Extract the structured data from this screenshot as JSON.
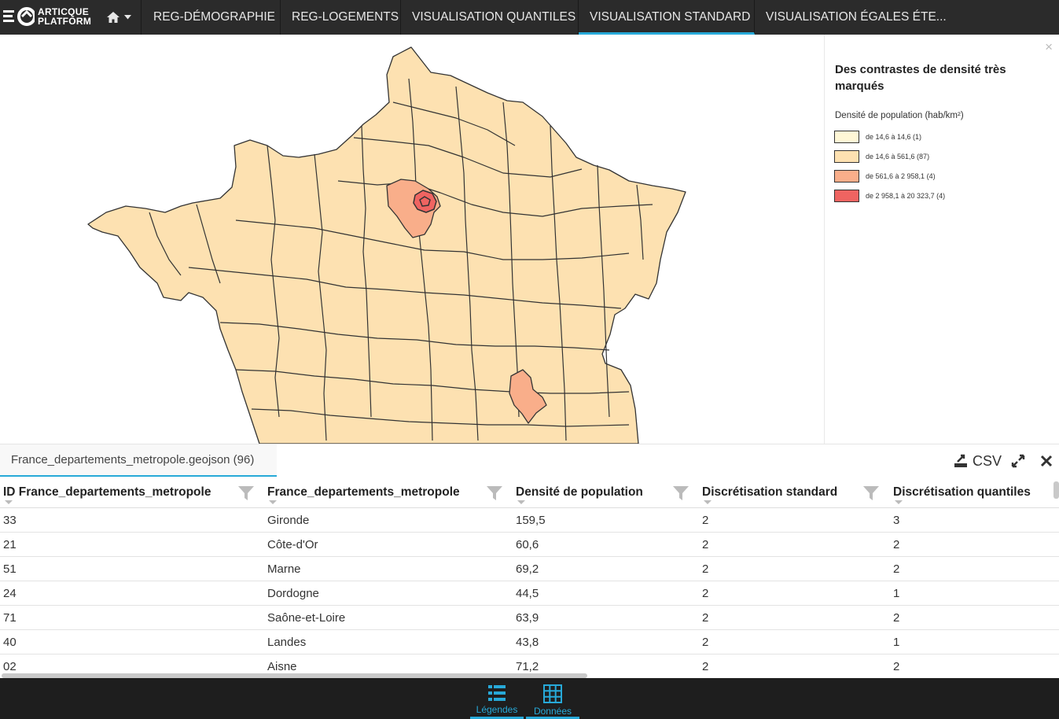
{
  "app": {
    "logo_line1": "ARTICQUE",
    "logo_line2": "PLATFORM"
  },
  "nav": {
    "tabs": [
      {
        "label": "REG-DÉMOGRAPHIE",
        "active": false
      },
      {
        "label": "REG-LOGEMENTS",
        "active": false
      },
      {
        "label": "VISUALISATION QUANTILES",
        "active": false
      },
      {
        "label": "VISUALISATION STANDARD",
        "active": true
      },
      {
        "label": "VISUALISATION ÉGALES ÉTE...",
        "active": false
      }
    ]
  },
  "legend": {
    "title": "Des contrastes de densité très marqués",
    "subtitle": "Densité de population (hab/km²)",
    "items": [
      {
        "label": "de 14,6 à 14,6 (1)",
        "color": "#fff7d6"
      },
      {
        "label": "de 14,6 à 561,6 (87)",
        "color": "#fde1b1"
      },
      {
        "label": "de 561,6 à 2 958,1 (4)",
        "color": "#f9ae8a"
      },
      {
        "label": "de 2 958,1 à 20 323,7 (4)",
        "color": "#ef6461"
      }
    ],
    "close_symbol": "×"
  },
  "data_panel": {
    "layer_tab": "France_departements_metropole.geojson (96)",
    "csv_label": "CSV",
    "columns": [
      "ID France_departements_metropole",
      "France_departements_metropole",
      "Densité de population",
      "Discrétisation standard",
      "Discrétisation quantiles"
    ],
    "rows": [
      [
        "33",
        "Gironde",
        "159,5",
        "2",
        "3"
      ],
      [
        "21",
        "Côte-d'Or",
        "60,6",
        "2",
        "2"
      ],
      [
        "51",
        "Marne",
        "69,2",
        "2",
        "2"
      ],
      [
        "24",
        "Dordogne",
        "44,5",
        "2",
        "1"
      ],
      [
        "71",
        "Saône-et-Loire",
        "63,9",
        "2",
        "2"
      ],
      [
        "40",
        "Landes",
        "43,8",
        "2",
        "1"
      ],
      [
        "02",
        "Aisne",
        "71,2",
        "2",
        "2"
      ]
    ]
  },
  "bottom_bar": {
    "legend_label": "Légendes",
    "data_label": "Données"
  },
  "colors": {
    "accent": "#27a9d8",
    "nav_bg": "#2b2b2b",
    "map_fill": "#fde1b1",
    "map_stroke": "#333333"
  }
}
